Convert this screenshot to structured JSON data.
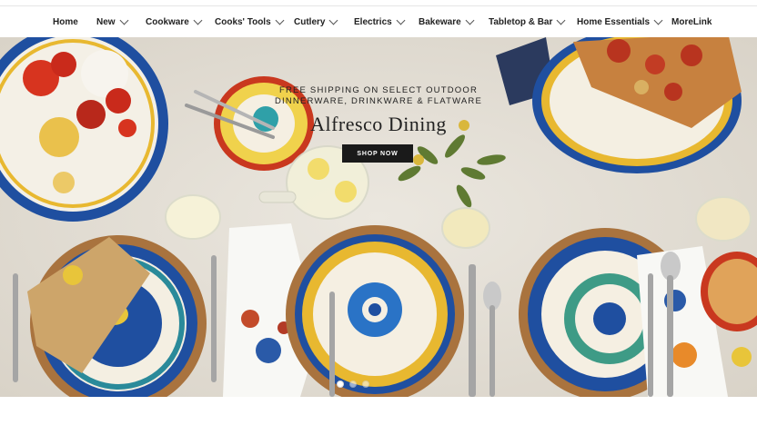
{
  "nav": {
    "items": [
      {
        "label": "Home",
        "has_dropdown": false
      },
      {
        "label": "New",
        "has_dropdown": true
      },
      {
        "label": "Cookware",
        "has_dropdown": true
      },
      {
        "label": "Cooks' Tools",
        "has_dropdown": true
      },
      {
        "label": "Cutlery",
        "has_dropdown": true
      },
      {
        "label": "Electrics",
        "has_dropdown": true
      },
      {
        "label": "Bakeware",
        "has_dropdown": true
      },
      {
        "label": "Tabletop & Bar",
        "has_dropdown": true
      },
      {
        "label": "Home Essentials",
        "has_dropdown": true
      },
      {
        "label": "MoreLink",
        "has_dropdown": false
      }
    ]
  },
  "hero": {
    "shipping_line1": "FREE SHIPPING ON SELECT OUTDOOR",
    "shipping_line2": "DINNERWARE, DRINKWARE & FLATWARE",
    "title": "Alfresco Dining",
    "cta": "SHOP NOW",
    "slides_count": 3,
    "active_slide": 1
  },
  "colors": {
    "cta_bg": "#1a1a1a",
    "cobalt": "#1f4fa0",
    "saffron": "#e8b830",
    "linen": "#e6e1d8",
    "olive_wood": "#a9733e"
  }
}
